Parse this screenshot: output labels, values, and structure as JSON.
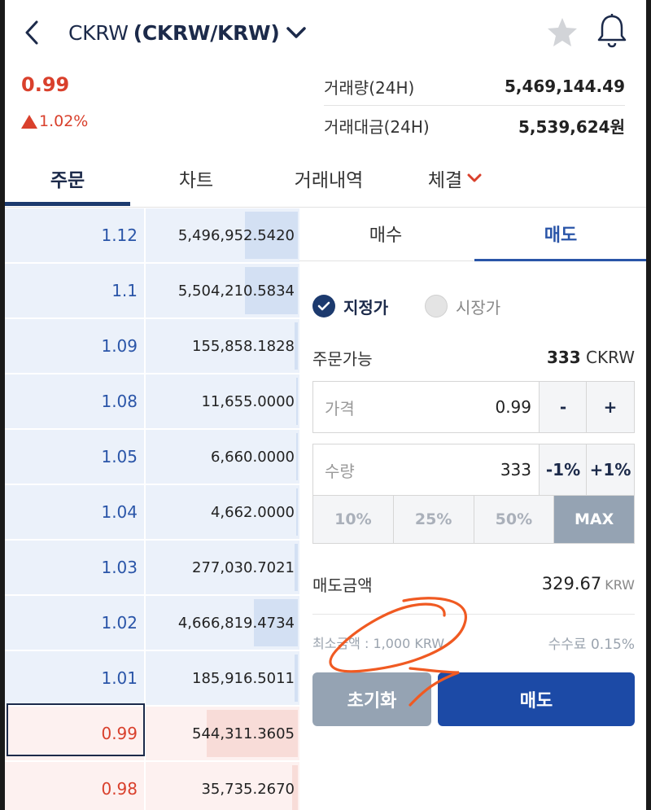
{
  "header": {
    "coin": "CKRW",
    "pair": "(CKRW/KRW)",
    "price": "0.99",
    "change": "1.02%",
    "stats": [
      {
        "label": "거래량(24H)",
        "value": "5,469,144.49"
      },
      {
        "label": "거래대금(24H)",
        "value": "5,539,624원"
      }
    ]
  },
  "tabs": [
    {
      "label": "주문",
      "active": true
    },
    {
      "label": "차트",
      "active": false
    },
    {
      "label": "거래내역",
      "active": false
    },
    {
      "label": "체결",
      "active": false
    }
  ],
  "orderbook": {
    "asks": [
      {
        "price": "1.12",
        "qty": "5,496,952.5420",
        "fill": 0.36
      },
      {
        "price": "1.1",
        "qty": "5,504,210.5834",
        "fill": 0.36
      },
      {
        "price": "1.09",
        "qty": "155,858.1828",
        "fill": 0.02
      },
      {
        "price": "1.08",
        "qty": "11,655.0000",
        "fill": 0.01
      },
      {
        "price": "1.05",
        "qty": "6,660.0000",
        "fill": 0.01
      },
      {
        "price": "1.04",
        "qty": "4,662.0000",
        "fill": 0.01
      },
      {
        "price": "1.03",
        "qty": "277,030.7021",
        "fill": 0.02
      },
      {
        "price": "1.02",
        "qty": "4,666,819.4734",
        "fill": 0.3
      },
      {
        "price": "1.01",
        "qty": "185,916.5011",
        "fill": 0.02
      }
    ],
    "bids": [
      {
        "price": "0.99",
        "qty": "544,311.3605",
        "fill": 0.62
      },
      {
        "price": "0.98",
        "qty": "35,735.2670",
        "fill": 0.04
      }
    ]
  },
  "order_panel": {
    "tabs": [
      {
        "label": "매수",
        "active": false
      },
      {
        "label": "매도",
        "active": true
      }
    ],
    "types": [
      {
        "label": "지정가",
        "selected": true
      },
      {
        "label": "시장가",
        "selected": false
      }
    ],
    "available_label": "주문가능",
    "available_value": "333",
    "available_unit": "CKRW",
    "price_label": "가격",
    "price_value": "0.99",
    "price_minus": "-",
    "price_plus": "+",
    "qty_label": "수량",
    "qty_value": "333",
    "qty_minus": "-1%",
    "qty_plus": "+1%",
    "percents": [
      {
        "label": "10%",
        "active": false
      },
      {
        "label": "25%",
        "active": false
      },
      {
        "label": "50%",
        "active": false
      },
      {
        "label": "MAX",
        "active": true
      }
    ],
    "amount_label": "매도금액",
    "amount_value": "329.67",
    "amount_unit": "KRW",
    "min_amount": "최소금액 : 1,000 KRW",
    "fee": "수수료 0.15%",
    "reset_label": "초기화",
    "sell_label": "매도"
  },
  "colors": {
    "accent": "#1c3a6e",
    "sell_blue": "#1c4aa6",
    "up_red": "#d9402c",
    "annotation": "#f05a22"
  }
}
